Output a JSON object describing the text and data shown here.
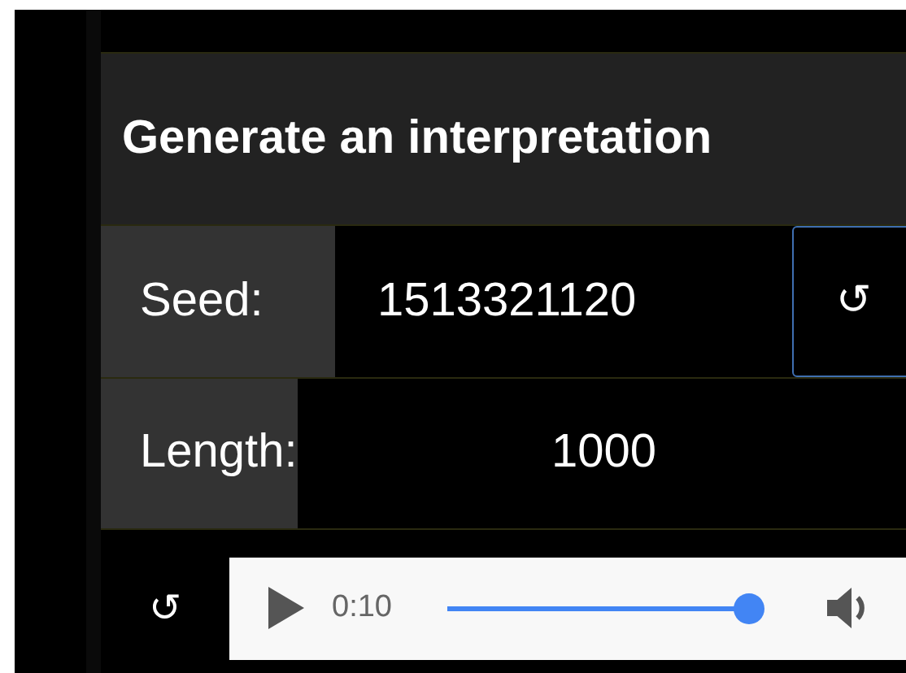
{
  "title": "Generate an interpretation",
  "fields": [
    {
      "label": "Seed:",
      "value": "1513321120",
      "button": "↺"
    },
    {
      "label": "Length:",
      "value": "1000"
    }
  ],
  "player": {
    "reload": "↺",
    "time": "0:10",
    "level": 0.96
  }
}
